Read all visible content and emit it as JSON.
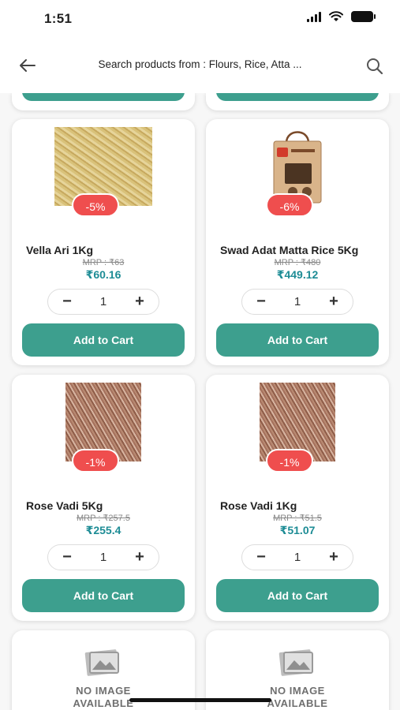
{
  "status": {
    "time": "1:51"
  },
  "header": {
    "title": "Search products from : Flours, Rice, Atta ..."
  },
  "products": [
    {
      "name": "Vella Ari 1Kg",
      "discount": "-5%",
      "mrp": "MRP : ₹63",
      "price": "₹60.16",
      "qty": "1",
      "add_label": "Add to Cart"
    },
    {
      "name": "Swad Adat Matta Rice 5Kg",
      "discount": "-6%",
      "mrp": "MRP : ₹480",
      "price": "₹449.12",
      "qty": "1",
      "add_label": "Add to Cart"
    },
    {
      "name": "Rose Vadi 5Kg",
      "discount": "-1%",
      "mrp": "MRP : ₹257.5",
      "price": "₹255.4",
      "qty": "1",
      "add_label": "Add to Cart"
    },
    {
      "name": "Rose Vadi 1Kg",
      "discount": "-1%",
      "mrp": "MRP : ₹51.5",
      "price": "₹51.07",
      "qty": "1",
      "add_label": "Add to Cart"
    }
  ],
  "placeholder": {
    "line1": "NO IMAGE",
    "line2": "AVAILABLE"
  },
  "colors": {
    "accent": "#3d9f8e",
    "discount": "#ef4e4e",
    "price": "#1d8c95"
  }
}
